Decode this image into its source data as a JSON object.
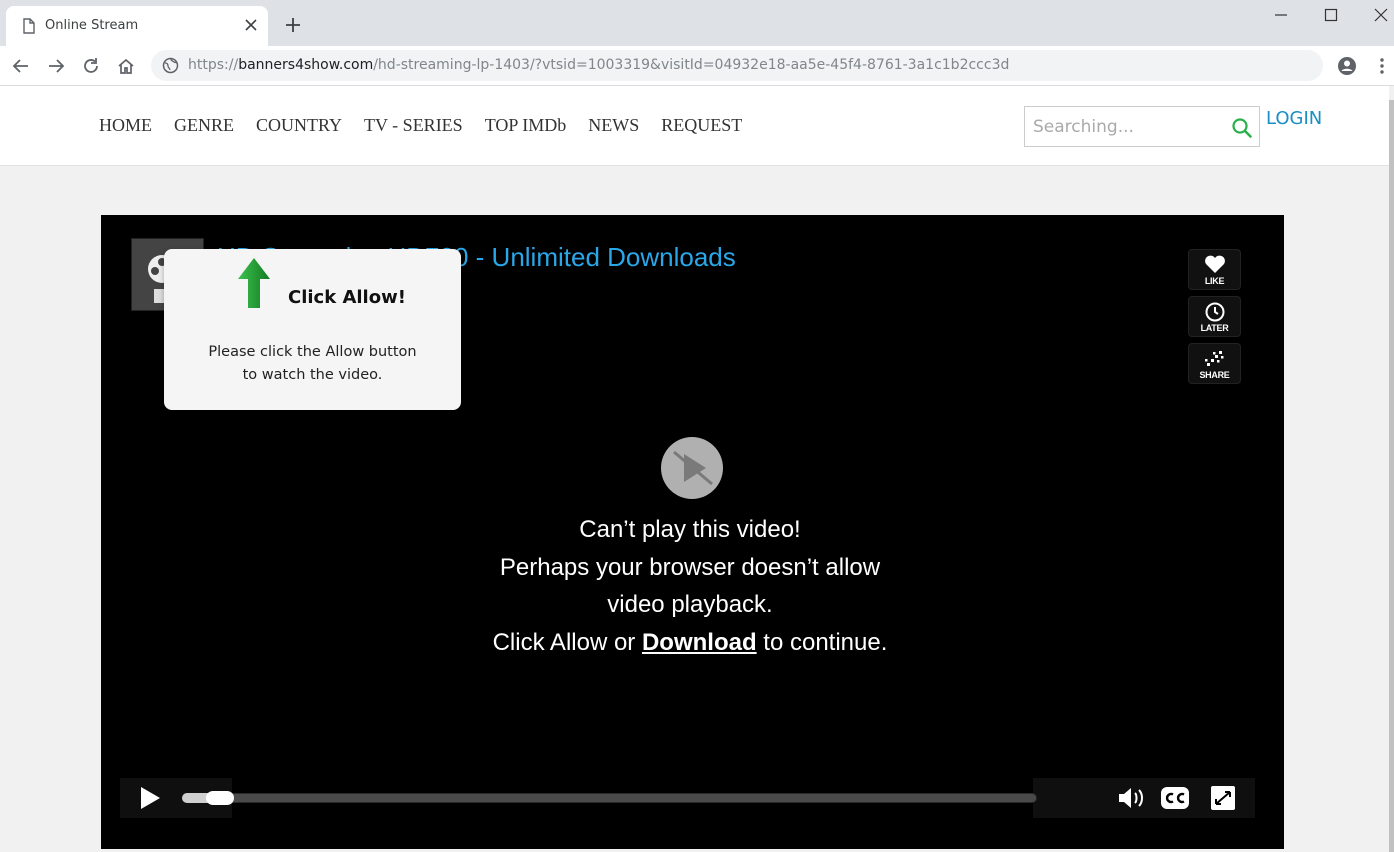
{
  "browser": {
    "tab_title": "Online Stream",
    "url_scheme": "https://",
    "url_host": "banners4show.com",
    "url_path": "/hd-streaming-lp-1403/?vtsid=1003319&visitId=04932e18-aa5e-45f4-8761-3a1c1b2ccc3d"
  },
  "site": {
    "nav": [
      "HOME",
      "GENRE",
      "COUNTRY",
      "TV - SERIES",
      "TOP IMDb",
      "NEWS",
      "REQUEST"
    ],
    "search_placeholder": "Searching...",
    "login_label": "LOGIN"
  },
  "player": {
    "title": "HD Streaming HD720 - Unlimited Downloads",
    "like_label": "LIKE",
    "later_label": "LATER",
    "share_label": "SHARE",
    "message_line1": "Can’t play this video!",
    "message_line2": "Perhaps your browser doesn’t allow",
    "message_line3": "video playback.",
    "message_line4_prefix": "Click Allow or ",
    "message_line4_link": "Download",
    "message_line4_suffix": " to continue.",
    "progress": 0.03
  },
  "popup": {
    "title": "Click Allow!",
    "body_line1": "Please click the Allow button",
    "body_line2": "to watch the video."
  },
  "colors": {
    "title_blue": "#2aa7e8",
    "login_blue": "#1a8fc4",
    "search_green": "#2ab04a",
    "arrow_green": "#1e9a30"
  }
}
